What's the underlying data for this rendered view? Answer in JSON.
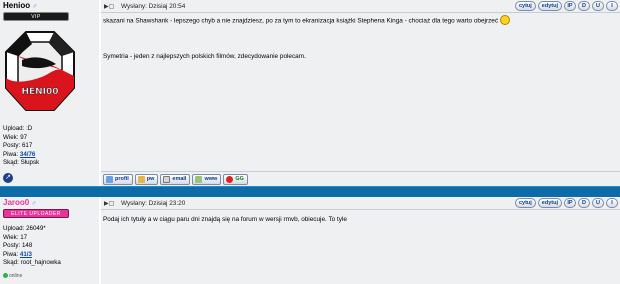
{
  "post1": {
    "username": "Henioo",
    "gender_symbol": "♂",
    "rank": "VIP",
    "stats": {
      "upload_label": "Upload:",
      "upload": ":D",
      "age_label": "Wiek:",
      "age": "97",
      "posts_label": "Posty:",
      "posts": "617",
      "beer_label": "Piwa:",
      "beer": "34/76",
      "squad_label": "Skąd:",
      "squad": "Słupsk"
    },
    "posted_label": "Wysłany:",
    "posted_time": "Dzisiaj 20:54",
    "buttons": {
      "quote": "cytuj",
      "edit": "edytuj",
      "ip": "IP",
      "delete": "D",
      "upgrade": "U",
      "info": "I"
    },
    "paragraphs": [
      "skazani na Shawshank - lepszego chyb a nie znajdziesz, po za tym to ekranizacja książki Stephena Kinga - chociaż dla tego warto obejrzeć",
      "Symetria - jeden z najlepszych polskich filmów, zdecydowanie polecam."
    ],
    "footer_buttons": {
      "profile": "profil",
      "pm": "pw",
      "email": "email",
      "www": "www",
      "gg": "GG"
    }
  },
  "post2": {
    "username": "Jaroo0",
    "gender_symbol": "♂",
    "rank": "ELITE UPLOADER",
    "stats": {
      "upload_label": "Upload:",
      "upload": "26049*",
      "age_label": "Wiek:",
      "age": "17",
      "posts_label": "Posty:",
      "posts": "148",
      "beer_label": "Piwa:",
      "beer": "41/3",
      "squad_label": "Skąd:",
      "squad": "root_hajnowka"
    },
    "online": "online",
    "posted_label": "Wysłany:",
    "posted_time": "Dzisiaj 23:20",
    "buttons": {
      "quote": "cytuj",
      "edit": "edytuj",
      "ip": "IP",
      "delete": "D",
      "upgrade": "U",
      "info": "I"
    },
    "text": "Podaj ich tytuły a w ciągu paru dni znajdą się na forum w wersji rmvb, obiecuje. To tyle"
  },
  "colors": {
    "separator": "#0d6ba8",
    "row_bg": "#eff0f2",
    "elite_badge": "#e8349a"
  }
}
